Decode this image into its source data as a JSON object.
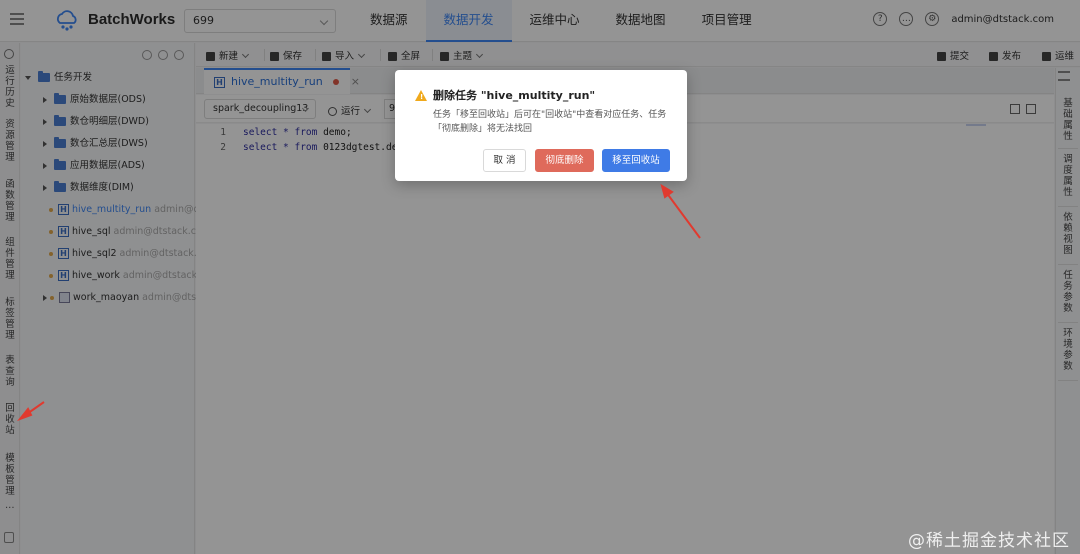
{
  "header": {
    "brand": "BatchWorks",
    "project_value": "699",
    "nav": [
      "数据源",
      "数据开发",
      "运维中心",
      "数据地图",
      "项目管理"
    ],
    "active_nav_index": 1,
    "user": "admin@dtstack.com",
    "icons": [
      "help-icon",
      "message-icon",
      "settings-icon"
    ]
  },
  "left_strip": {
    "items": [
      "运行历史",
      "资源管理",
      "函数管理",
      "组件管理",
      "标签管理",
      "表查询",
      "回收站",
      "模板管理"
    ],
    "more": "..."
  },
  "tree": {
    "root": "任务开发",
    "folders": [
      "原始数据层(ODS)",
      "数仓明细层(DWD)",
      "数仓汇总层(DWS)",
      "应用数据层(ADS)",
      "数据维度(DIM)"
    ],
    "tasks": [
      {
        "name": "hive_multity_run",
        "owner": "admin@dtsta"
      },
      {
        "name": "hive_sql",
        "owner": "admin@dtstack.com"
      },
      {
        "name": "hive_sql2",
        "owner": "admin@dtstack.con"
      },
      {
        "name": "hive_work",
        "owner": "admin@dtstack.cor"
      }
    ],
    "workflow": {
      "name": "work_maoyan",
      "owner": "admin@dtstack"
    }
  },
  "toolbar": {
    "new": "新建",
    "save": "保存",
    "import": "导入",
    "fullscreen": "全屏",
    "theme": "主题",
    "submit": "提交",
    "publish": "发布",
    "ops": "运维"
  },
  "tab": {
    "icon_letter": "H",
    "name": "hive_multity_run",
    "close": "×"
  },
  "editor": {
    "datasource": "spark_decoupling13",
    "run": "运行",
    "run_param": "9",
    "lines": [
      {
        "num": "1",
        "kw": "select * from",
        "text": " demo;"
      },
      {
        "num": "2",
        "kw": "select * from",
        "text": " 0123dgtest.de"
      }
    ]
  },
  "right_strip": {
    "items": [
      "基础属性",
      "调度属性",
      "依赖视图",
      "任务参数",
      "环境参数"
    ]
  },
  "modal": {
    "title": "删除任务 \"hive_multity_run\"",
    "body_line1": "任务「移至回收站」后可在\"回收站\"中查看对应任务、任务",
    "body_line2": "「彻底删除」将无法找回",
    "cancel": "取 消",
    "delete": "彻底删除",
    "move": "移至回收站"
  },
  "watermark": "@稀土掘金技术社区",
  "colors": {
    "primary": "#3f87f5",
    "danger": "#df6a5b",
    "warning": "#f0a91c",
    "annotation_arrow": "#e03a2f"
  }
}
